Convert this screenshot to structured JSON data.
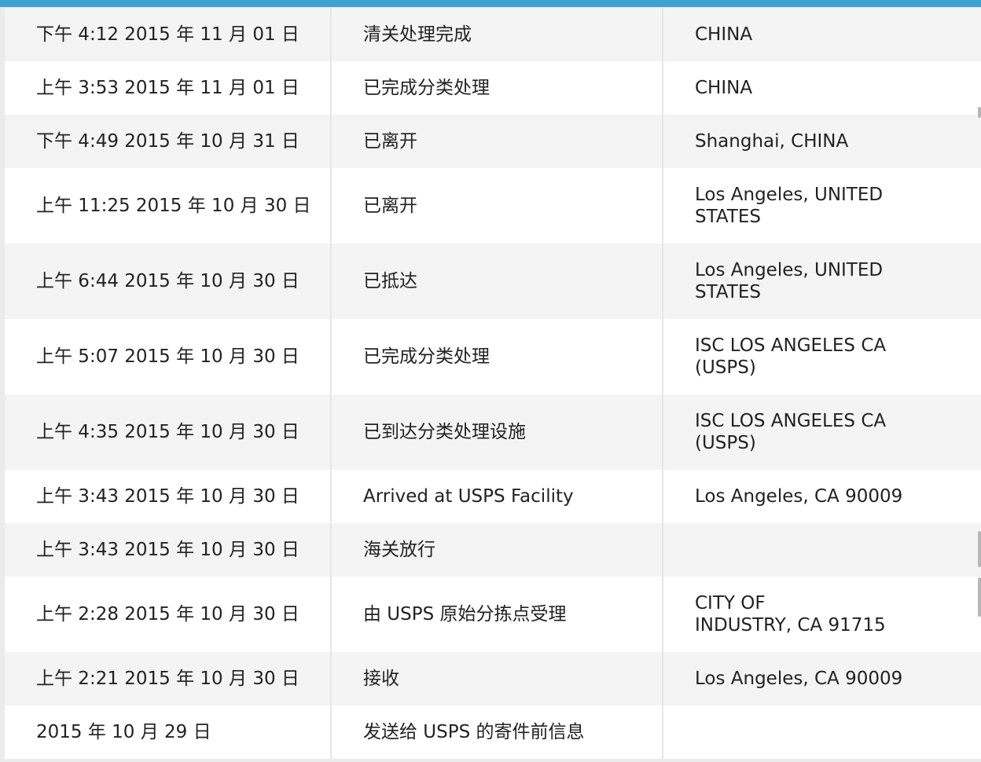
{
  "tracking_table": {
    "rows": [
      {
        "date": "下午 4:12 2015 年 11 月 01 日",
        "status": "清关处理完成",
        "location": "CHINA"
      },
      {
        "date": "上午 3:53 2015 年 11 月 01 日",
        "status": "已完成分类处理",
        "location": "CHINA"
      },
      {
        "date": "下午 4:49 2015 年 10 月 31 日",
        "status": "已离开",
        "location": "Shanghai, CHINA"
      },
      {
        "date": "上午 11:25 2015 年 10 月 30 日",
        "status": "已离开",
        "location": "Los Angeles, UNITED\nSTATES"
      },
      {
        "date": "上午 6:44 2015 年 10 月 30 日",
        "status": "已抵达",
        "location": "Los Angeles, UNITED\nSTATES"
      },
      {
        "date": "上午 5:07 2015 年 10 月 30 日",
        "status": "已完成分类处理",
        "location": "ISC LOS ANGELES CA\n(USPS)"
      },
      {
        "date": "上午 4:35 2015 年 10 月 30 日",
        "status": "已到达分类处理设施",
        "location": "ISC LOS ANGELES CA\n(USPS)"
      },
      {
        "date": "上午 3:43 2015 年 10 月 30 日",
        "status": "Arrived at USPS Facility",
        "location": "Los Angeles, CA 90009"
      },
      {
        "date": "上午 3:43 2015 年 10 月 30 日",
        "status": "海关放行",
        "location": ""
      },
      {
        "date": "上午 2:28 2015 年 10 月 30 日",
        "status": "由 USPS 原始分拣点受理",
        "location": "CITY OF\nINDUSTRY, CA 91715"
      },
      {
        "date": "上午 2:21 2015 年 10 月 30 日",
        "status": "接收",
        "location": "Los Angeles, CA 90009"
      },
      {
        "date": "2015 年 10 月 29 日",
        "status": "发送给 USPS 的寄件前信息",
        "location": ""
      }
    ]
  }
}
